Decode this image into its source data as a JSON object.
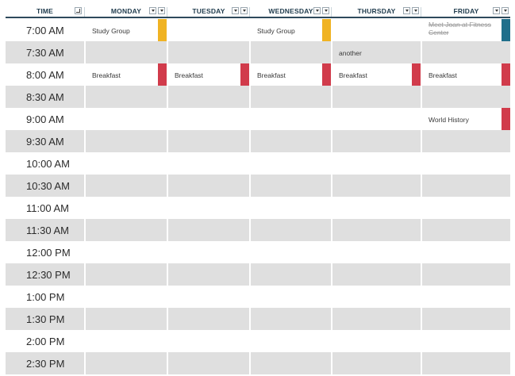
{
  "header": {
    "time_label": "TIME",
    "days": [
      "MONDAY",
      "TUESDAY",
      "WEDNESDAY",
      "THURSDAY",
      "FRIDAY"
    ]
  },
  "times": [
    "7:00 AM",
    "7:30 AM",
    "8:00 AM",
    "8:30 AM",
    "9:00 AM",
    "9:30 AM",
    "10:00 AM",
    "10:30 AM",
    "11:00 AM",
    "11:30 AM",
    "12:00 PM",
    "12:30 PM",
    "1:00 PM",
    "1:30 PM",
    "2:00 PM",
    "2:30 PM"
  ],
  "events": [
    {
      "day": 0,
      "slot": 0,
      "text": "Study Group",
      "color": "#f0b323"
    },
    {
      "day": 2,
      "slot": 0,
      "text": "Study Group",
      "color": "#f0b323"
    },
    {
      "day": 4,
      "slot": 0,
      "text": "Meet Joan at Fitness Center",
      "color": "#1f6f8b",
      "strikethrough": true
    },
    {
      "day": 3,
      "slot": 1,
      "text": "another"
    },
    {
      "day": 0,
      "slot": 2,
      "text": "Breakfast",
      "color": "#d13b4b"
    },
    {
      "day": 1,
      "slot": 2,
      "text": "Breakfast",
      "color": "#d13b4b"
    },
    {
      "day": 2,
      "slot": 2,
      "text": "Breakfast",
      "color": "#d13b4b"
    },
    {
      "day": 3,
      "slot": 2,
      "text": "Breakfast",
      "color": "#d13b4b"
    },
    {
      "day": 4,
      "slot": 2,
      "text": "Breakfast",
      "color": "#d13b4b"
    },
    {
      "day": 4,
      "slot": 4,
      "text": "World History",
      "color": "#d13b4b"
    }
  ],
  "colors": {
    "header_text": "#1f3b4d",
    "header_rule": "#2e4a5c",
    "alt_row": "#dfdfdf",
    "study_marker": "#f0b323",
    "breakfast_marker": "#d13b4b",
    "fitness_marker": "#1f6f8b"
  },
  "icons": {
    "time_header": "sort-icon",
    "day_header": [
      "filter-dropdown-icon",
      "filter-dropdown-icon"
    ]
  }
}
